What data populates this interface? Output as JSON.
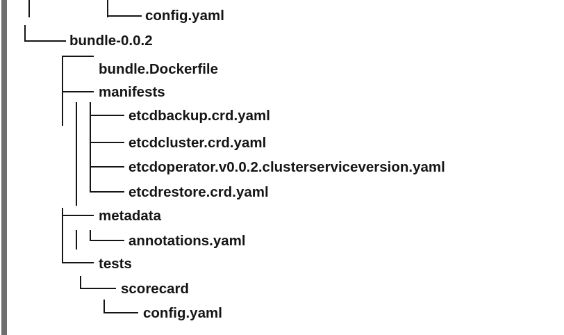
{
  "tree": {
    "entries": [
      {
        "label": "config.yaml"
      },
      {
        "label": "bundle-0.0.2"
      },
      {
        "label": "bundle.Dockerfile"
      },
      {
        "label": "manifests"
      },
      {
        "label": "etcdbackup.crd.yaml"
      },
      {
        "label": "etcdcluster.crd.yaml"
      },
      {
        "label": "etcdoperator.v0.0.2.clusterserviceversion.yaml"
      },
      {
        "label": "etcdrestore.crd.yaml"
      },
      {
        "label": "metadata"
      },
      {
        "label": "annotations.yaml"
      },
      {
        "label": "tests"
      },
      {
        "label": "scorecard"
      },
      {
        "label": "config.yaml"
      }
    ]
  },
  "colors": {
    "text": "#151515",
    "rule": "#6e6e6e",
    "background": "#ffffff"
  }
}
